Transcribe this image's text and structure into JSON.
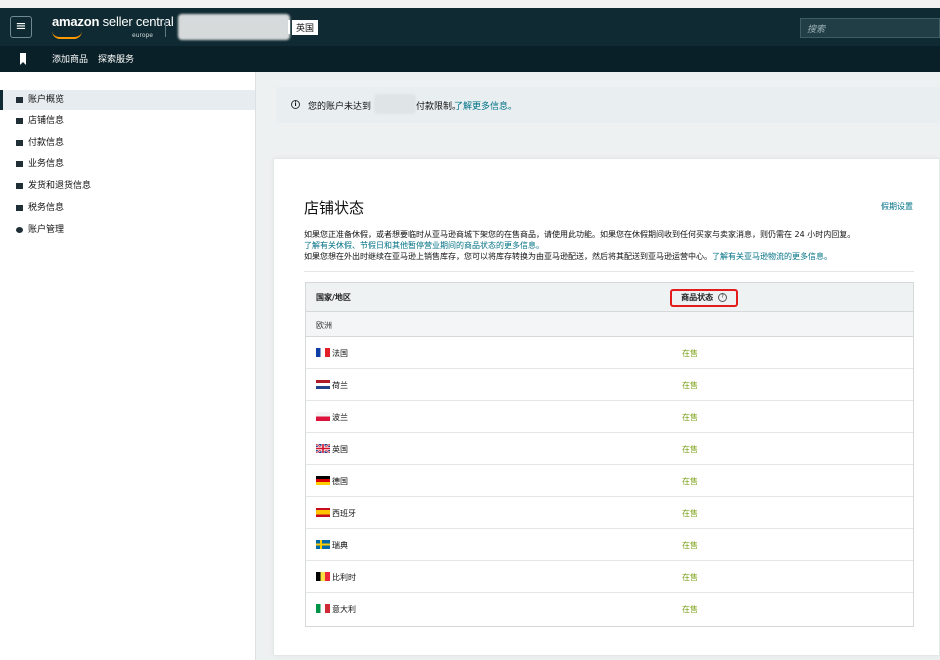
{
  "header": {
    "logo_prefix": "amazon",
    "logo_suffix": "seller central",
    "logo_region": "europe",
    "marketplace": "英国",
    "search_placeholder": "搜索"
  },
  "navbar": {
    "items": [
      "添加商品",
      "探索服务"
    ]
  },
  "sidebar": {
    "items": [
      {
        "label": "账户概览",
        "active": true
      },
      {
        "label": "店铺信息",
        "active": false
      },
      {
        "label": "付款信息",
        "active": false
      },
      {
        "label": "业务信息",
        "active": false
      },
      {
        "label": "发货和退货信息",
        "active": false
      },
      {
        "label": "税务信息",
        "active": false
      },
      {
        "label": "账户管理",
        "active": false
      }
    ]
  },
  "notice": {
    "text_before": "您的账户未达到",
    "text_after": "付款限制。",
    "link": "了解更多信息。"
  },
  "store_status": {
    "title": "店铺状态",
    "action": "假期设置",
    "para1": "如果您正准备休假，或者想要临时从亚马逊商城下架您的在售商品，请使用此功能。如果您在休假期间收到任何买家与卖家消息，则仍需在 24 小时内回复。",
    "para2_link": "了解有关休假、节假日和其他暂停营业期间的商品状态的更多信息。",
    "para3": "如果您想在外出时继续在亚马逊上销售库存，您可以将库存转换为由亚马逊配送，然后将其配送到亚马逊运营中心。",
    "para3_link": "了解有关亚马逊物流的更多信息。",
    "col_country": "国家/地区",
    "col_status": "商品状态",
    "group": "欧洲",
    "rows": [
      {
        "country": "法国",
        "status": "在售",
        "flag": "fr"
      },
      {
        "country": "荷兰",
        "status": "在售",
        "flag": "nl"
      },
      {
        "country": "波兰",
        "status": "在售",
        "flag": "pl"
      },
      {
        "country": "英国",
        "status": "在售",
        "flag": "uk"
      },
      {
        "country": "德国",
        "status": "在售",
        "flag": "de"
      },
      {
        "country": "西班牙",
        "status": "在售",
        "flag": "es"
      },
      {
        "country": "瑞典",
        "status": "在售",
        "flag": "se"
      },
      {
        "country": "比利时",
        "status": "在售",
        "flag": "be"
      },
      {
        "country": "意大利",
        "status": "在售",
        "flag": "it"
      }
    ]
  },
  "colors": {
    "header_bg": "#0f2a32",
    "nav_bg": "#0a2028",
    "link": "#007185",
    "status_green": "#7aa116",
    "highlight_red": "#e31b1b"
  }
}
